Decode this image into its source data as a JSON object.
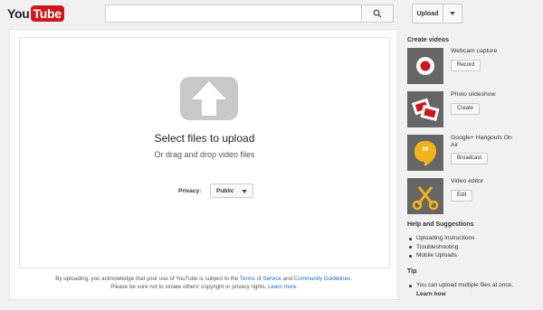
{
  "header": {
    "logo_you": "You",
    "logo_tube": "Tube",
    "search_value": "",
    "search_icon": "magnifier",
    "upload_label": "Upload"
  },
  "main": {
    "title": "Select files to upload",
    "subtitle": "Or drag and drop video files",
    "privacy_label": "Privacy:",
    "privacy_value": "Public",
    "terms_line1_prefix": "By uploading, you acknowledge that your use of YouTube is subject to the ",
    "terms_of_service": "Terms of Service",
    "terms_and": " and ",
    "community_guidelines": "Community Guidelines",
    "terms_line1_suffix": ".",
    "terms_line2": "Please be sure not to violate others' copyright or privacy rights. ",
    "learn_more": "Learn more"
  },
  "sidebar": {
    "create_heading": "Create videos",
    "tools": [
      {
        "name": "Webcam capture",
        "button": "Record",
        "icon": "webcam-record-icon"
      },
      {
        "name": "Photo slideshow",
        "button": "Create",
        "icon": "photo-slideshow-icon"
      },
      {
        "name": "Google+ Hangouts On Air",
        "button": "Broadcast",
        "icon": "hangouts-icon"
      },
      {
        "name": "Video editor",
        "button": "Edit",
        "icon": "scissors-icon"
      }
    ],
    "help_heading": "Help and Suggestions",
    "help_items": [
      "Uploading Instructions",
      "Troubleshooting",
      "Mobile Uploads"
    ],
    "tip_heading": "Tip",
    "tip_text": "You can upload multiple files at once.",
    "learn_how": "Learn how"
  },
  "colors": {
    "brand_red": "#cc181e",
    "link_blue": "#1b6cc2",
    "hangouts_yellow": "#f2b31a",
    "tool_bg": "#666666"
  }
}
